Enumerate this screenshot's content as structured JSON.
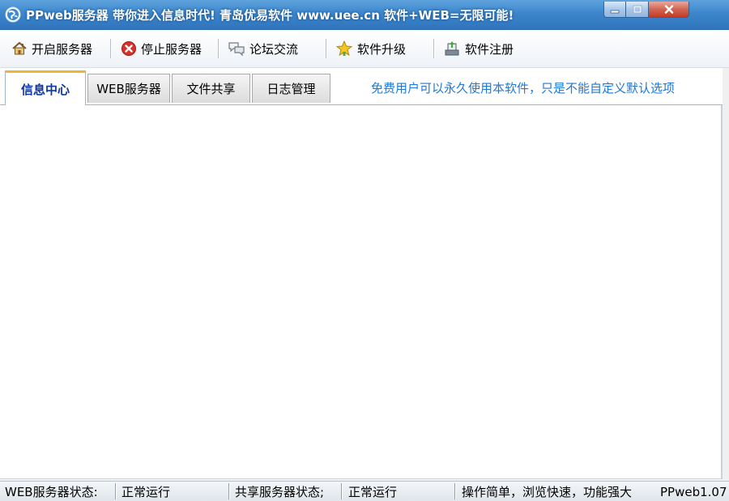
{
  "window": {
    "title": "PPweb服务器 带你进入信息时代! 青岛优易软件 www.uee.cn 软件+WEB=无限可能!",
    "controls": [
      "minimize-icon",
      "maximize-icon",
      "close-icon"
    ]
  },
  "toolbar": {
    "items": [
      {
        "label": "开启服务器",
        "icon": "home-icon"
      },
      {
        "label": "停止服务器",
        "icon": "stop-icon"
      },
      {
        "label": "论坛交流",
        "icon": "chat-bubbles-icon"
      },
      {
        "label": "软件升级",
        "icon": "star-icon"
      },
      {
        "label": "软件注册",
        "icon": "register-icon"
      }
    ]
  },
  "tabs": {
    "items": [
      {
        "label": "信息中心",
        "active": true
      },
      {
        "label": "WEB服务器",
        "active": false
      },
      {
        "label": "文件共享",
        "active": false
      },
      {
        "label": "日志管理",
        "active": false
      }
    ],
    "notice": "免费用户可以永久使用本软件，只是不能自定义默认选项"
  },
  "status": {
    "web_label": "WEB服务器状态:",
    "web_value": "正常运行",
    "share_label": "共享服务器状态;",
    "share_value": "正常运行",
    "slogan": "操作简单，浏览快速，功能强大",
    "version": "PPweb1.07"
  },
  "colors": {
    "titlebar": "#3d86cc",
    "active_tab_text": "#0c37a8",
    "active_tab_accent": "#f3b33a",
    "notice_text": "#1e78d8",
    "close_button": "#c43c24"
  }
}
